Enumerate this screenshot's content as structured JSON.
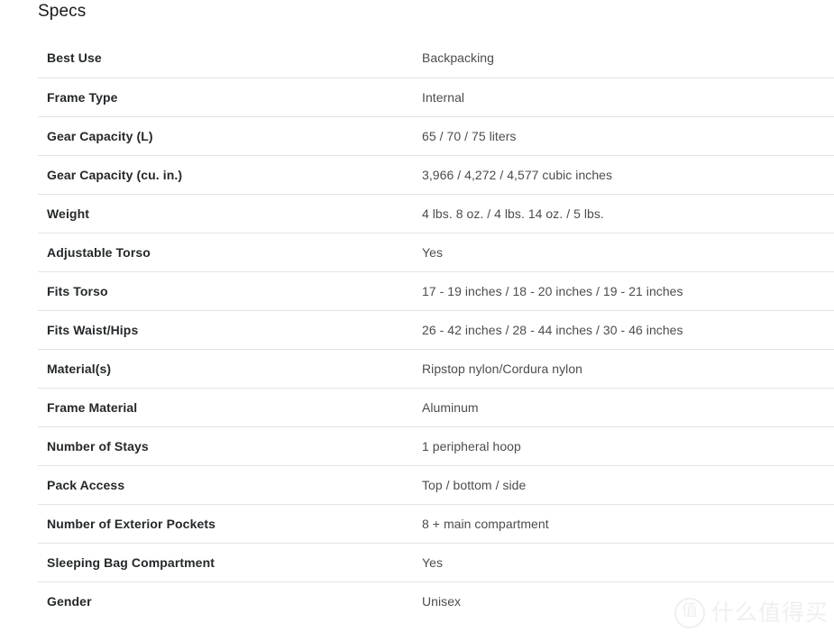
{
  "section": {
    "heading": "Specs"
  },
  "specs": {
    "rows": [
      {
        "label": "Best Use",
        "value": "Backpacking"
      },
      {
        "label": "Frame Type",
        "value": "Internal"
      },
      {
        "label": "Gear Capacity (L)",
        "value": "65 / 70 / 75 liters"
      },
      {
        "label": "Gear Capacity (cu. in.)",
        "value": "3,966 / 4,272 / 4,577 cubic inches"
      },
      {
        "label": "Weight",
        "value": "4 lbs. 8 oz. / 4 lbs. 14 oz. / 5 lbs."
      },
      {
        "label": "Adjustable Torso",
        "value": "Yes"
      },
      {
        "label": "Fits Torso",
        "value": "17 - 19 inches / 18 - 20 inches / 19 - 21 inches"
      },
      {
        "label": "Fits Waist/Hips",
        "value": "26 - 42 inches / 28 - 44 inches / 30 - 46 inches"
      },
      {
        "label": "Material(s)",
        "value": "Ripstop nylon/Cordura nylon"
      },
      {
        "label": "Frame Material",
        "value": "Aluminum"
      },
      {
        "label": "Number of Stays",
        "value": "1 peripheral hoop"
      },
      {
        "label": "Pack Access",
        "value": "Top / bottom / side"
      },
      {
        "label": "Number of Exterior Pockets",
        "value": "8 + main compartment"
      },
      {
        "label": "Sleeping Bag Compartment",
        "value": "Yes"
      },
      {
        "label": "Gender",
        "value": "Unisex"
      }
    ]
  },
  "watermark": {
    "mark": "值",
    "text": "什么值得买"
  },
  "colors": {
    "label_text": "#25282a",
    "value_text": "#4c4c4c",
    "divider": "#e3e3e3",
    "background": "#ffffff",
    "watermark": "#c9cdd2"
  }
}
